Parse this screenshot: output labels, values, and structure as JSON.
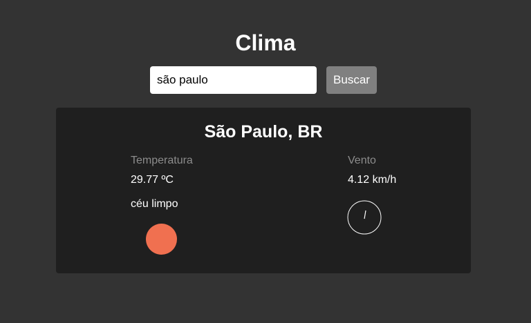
{
  "header": {
    "title": "Clima"
  },
  "search": {
    "value": "são paulo",
    "button_label": "Buscar"
  },
  "weather": {
    "city": "São Paulo, BR",
    "temperature_label": "Temperatura",
    "temperature_value": "29.77 ºC",
    "description": "céu limpo",
    "wind_label": "Vento",
    "wind_value": "4.12 km/h",
    "sun_color": "#f07050"
  },
  "icons": {
    "condition": "sun-icon",
    "wind": "wind-direction-compass-icon"
  }
}
